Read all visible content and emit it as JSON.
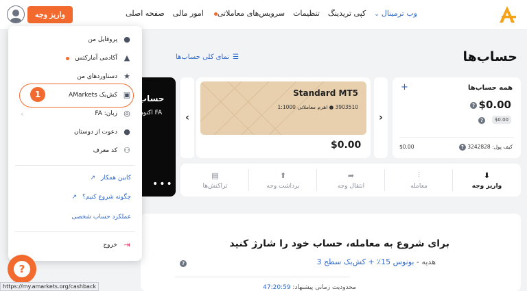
{
  "topbar": {
    "nav": [
      "صفحه اصلی",
      "امور مالی",
      "سرویس‌های معاملاتی",
      "تنظیمات",
      "کپی تریدینگ",
      "وب ترمینال"
    ],
    "deposit_label": "واریز وجه"
  },
  "page": {
    "title": "حساب‌ها",
    "overview_link": "نمای کلی حساب‌ها"
  },
  "all_accounts": {
    "title": "همه حساب‌ها",
    "total": "$0.00",
    "pill": "$0.00",
    "wallet_label": "کیف پول: 3242828",
    "wallet_value": "$0.00"
  },
  "mt5": {
    "title": "Standard MT5",
    "subtitle": "3903510 ● اهرم معاملاتی 1:1000",
    "balance": "$0.00"
  },
  "black_card": {
    "title": "حساب",
    "subtitle": "اکنون FA"
  },
  "actions": [
    "واریز وجه",
    "معامله",
    "انتقال وجه",
    "برداشت وجه",
    "تراکنش‌ها"
  ],
  "promo": {
    "title": "برای شروع به معامله، حساب خود را شارژ کنید",
    "prefix": "هدیه - ",
    "highlight": "بونوس 15٪ + کش‌بک سطح 3",
    "timer_label": "محدودیت زمانی پیشنهاد: ",
    "timer": "47:20:59"
  },
  "menu": {
    "items": [
      "پروفایل من",
      "آکادمی آمارکتس",
      "دستاوردهای من",
      "کش‌بک AMarkets",
      "زبان: FA",
      "دعوت از دوستان",
      "کد معرف"
    ],
    "links": [
      "کابین همکار",
      "چگونه شروع کنیم؟",
      "عملکرد حساب شخصی"
    ],
    "logout": "خروج",
    "badge": "1"
  },
  "status_url": "https://my.amarkets.org/cashback",
  "colors": {
    "accent": "#f26a2e",
    "link": "#2f68c9",
    "card_sand": "#e8cfad"
  }
}
